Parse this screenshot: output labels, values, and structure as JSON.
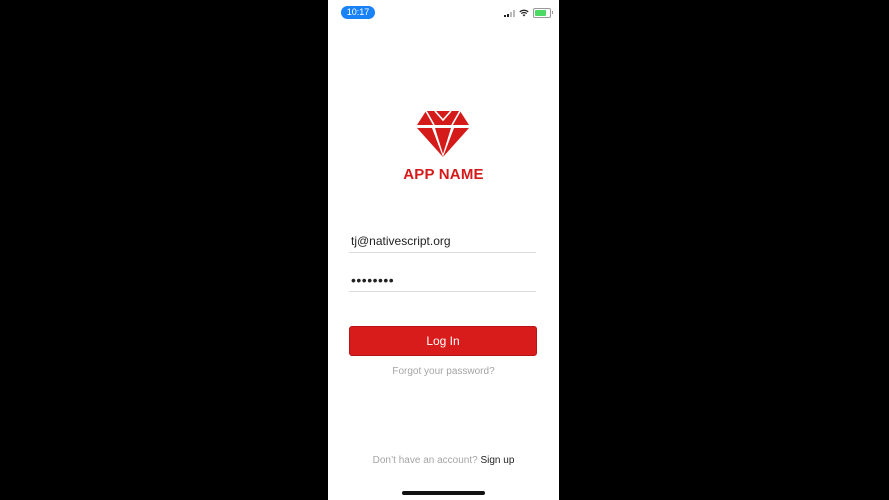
{
  "status_bar": {
    "time": "10:17",
    "icons": [
      "cellular-signal-icon",
      "wifi-icon",
      "battery-charging-icon"
    ]
  },
  "brand": {
    "logo_icon": "diamond-gem-icon",
    "app_name": "APP NAME",
    "accent_color": "#d51a1a"
  },
  "login_form": {
    "email": {
      "value": "tj@nativescript.org"
    },
    "password": {
      "value": "password"
    },
    "login_button_label": "Log In",
    "forgot_password_label": "Forgot your password?"
  },
  "footer": {
    "signup_prompt": "Don’t have an account?",
    "signup_link": "Sign up"
  }
}
